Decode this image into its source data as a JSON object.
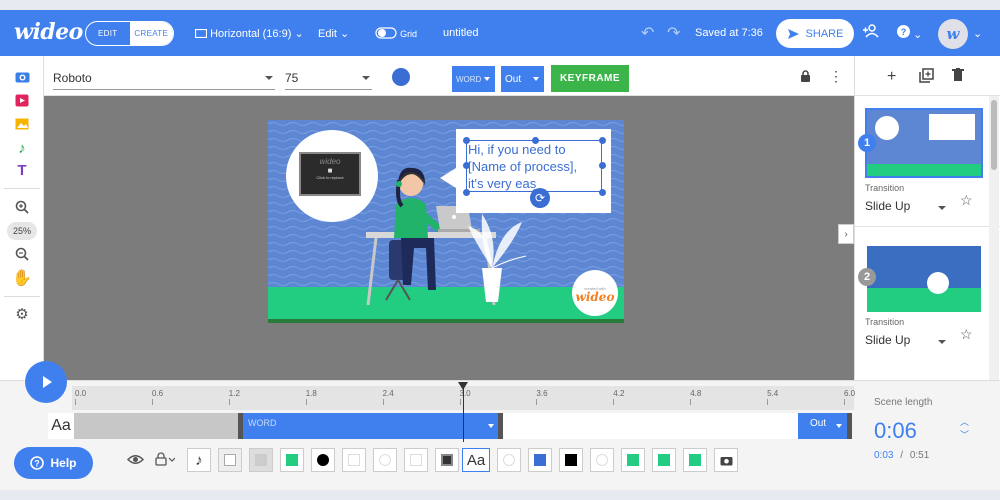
{
  "app": {
    "logo": "wideo",
    "mode_edit": "EDIT",
    "mode_create": "CREATE",
    "format": "Horizontal (16:9)",
    "edit_menu": "Edit",
    "grid_label": "Grid",
    "project_name": "untitled",
    "saved_status": "Saved at 7:36",
    "share_label": "SHARE",
    "avatar_letter": "w",
    "accent_color": "#4080ee"
  },
  "left_tools": {
    "zoom_percent": "25%"
  },
  "properties": {
    "font_family": "Roboto",
    "font_size": "75",
    "text_color": "#3a6ed3",
    "in_animation": "WORD",
    "out_animation": "Out",
    "keyframe_label": "KEYFRAME"
  },
  "stage": {
    "speech_line1": "Hi, if you need to",
    "speech_line2": "[Name of process],",
    "speech_line3": "it's very eas",
    "photo_caption": "Click to replace",
    "photo_logo": "wideo",
    "badge_logo": "wideo",
    "badge_small": "created with"
  },
  "scenes": [
    {
      "number": "1",
      "transition_label": "Transition",
      "transition_value": "Slide Up"
    },
    {
      "number": "2",
      "transition_label": "Transition",
      "transition_value": "Slide Up"
    }
  ],
  "timeline": {
    "ticks": [
      "0.0",
      "0.6",
      "1.2",
      "1.8",
      "2.4",
      "3.0",
      "3.6",
      "4.2",
      "4.8",
      "5.4",
      "6.0"
    ],
    "aa_label": "Aa",
    "word_track_label": "WORD",
    "out_track_label": "Out",
    "help_label": "Help",
    "scene_length_label": "Scene length",
    "scene_length": "0:06",
    "elapsed": "0:03",
    "separator": "/",
    "total": "0:51"
  }
}
